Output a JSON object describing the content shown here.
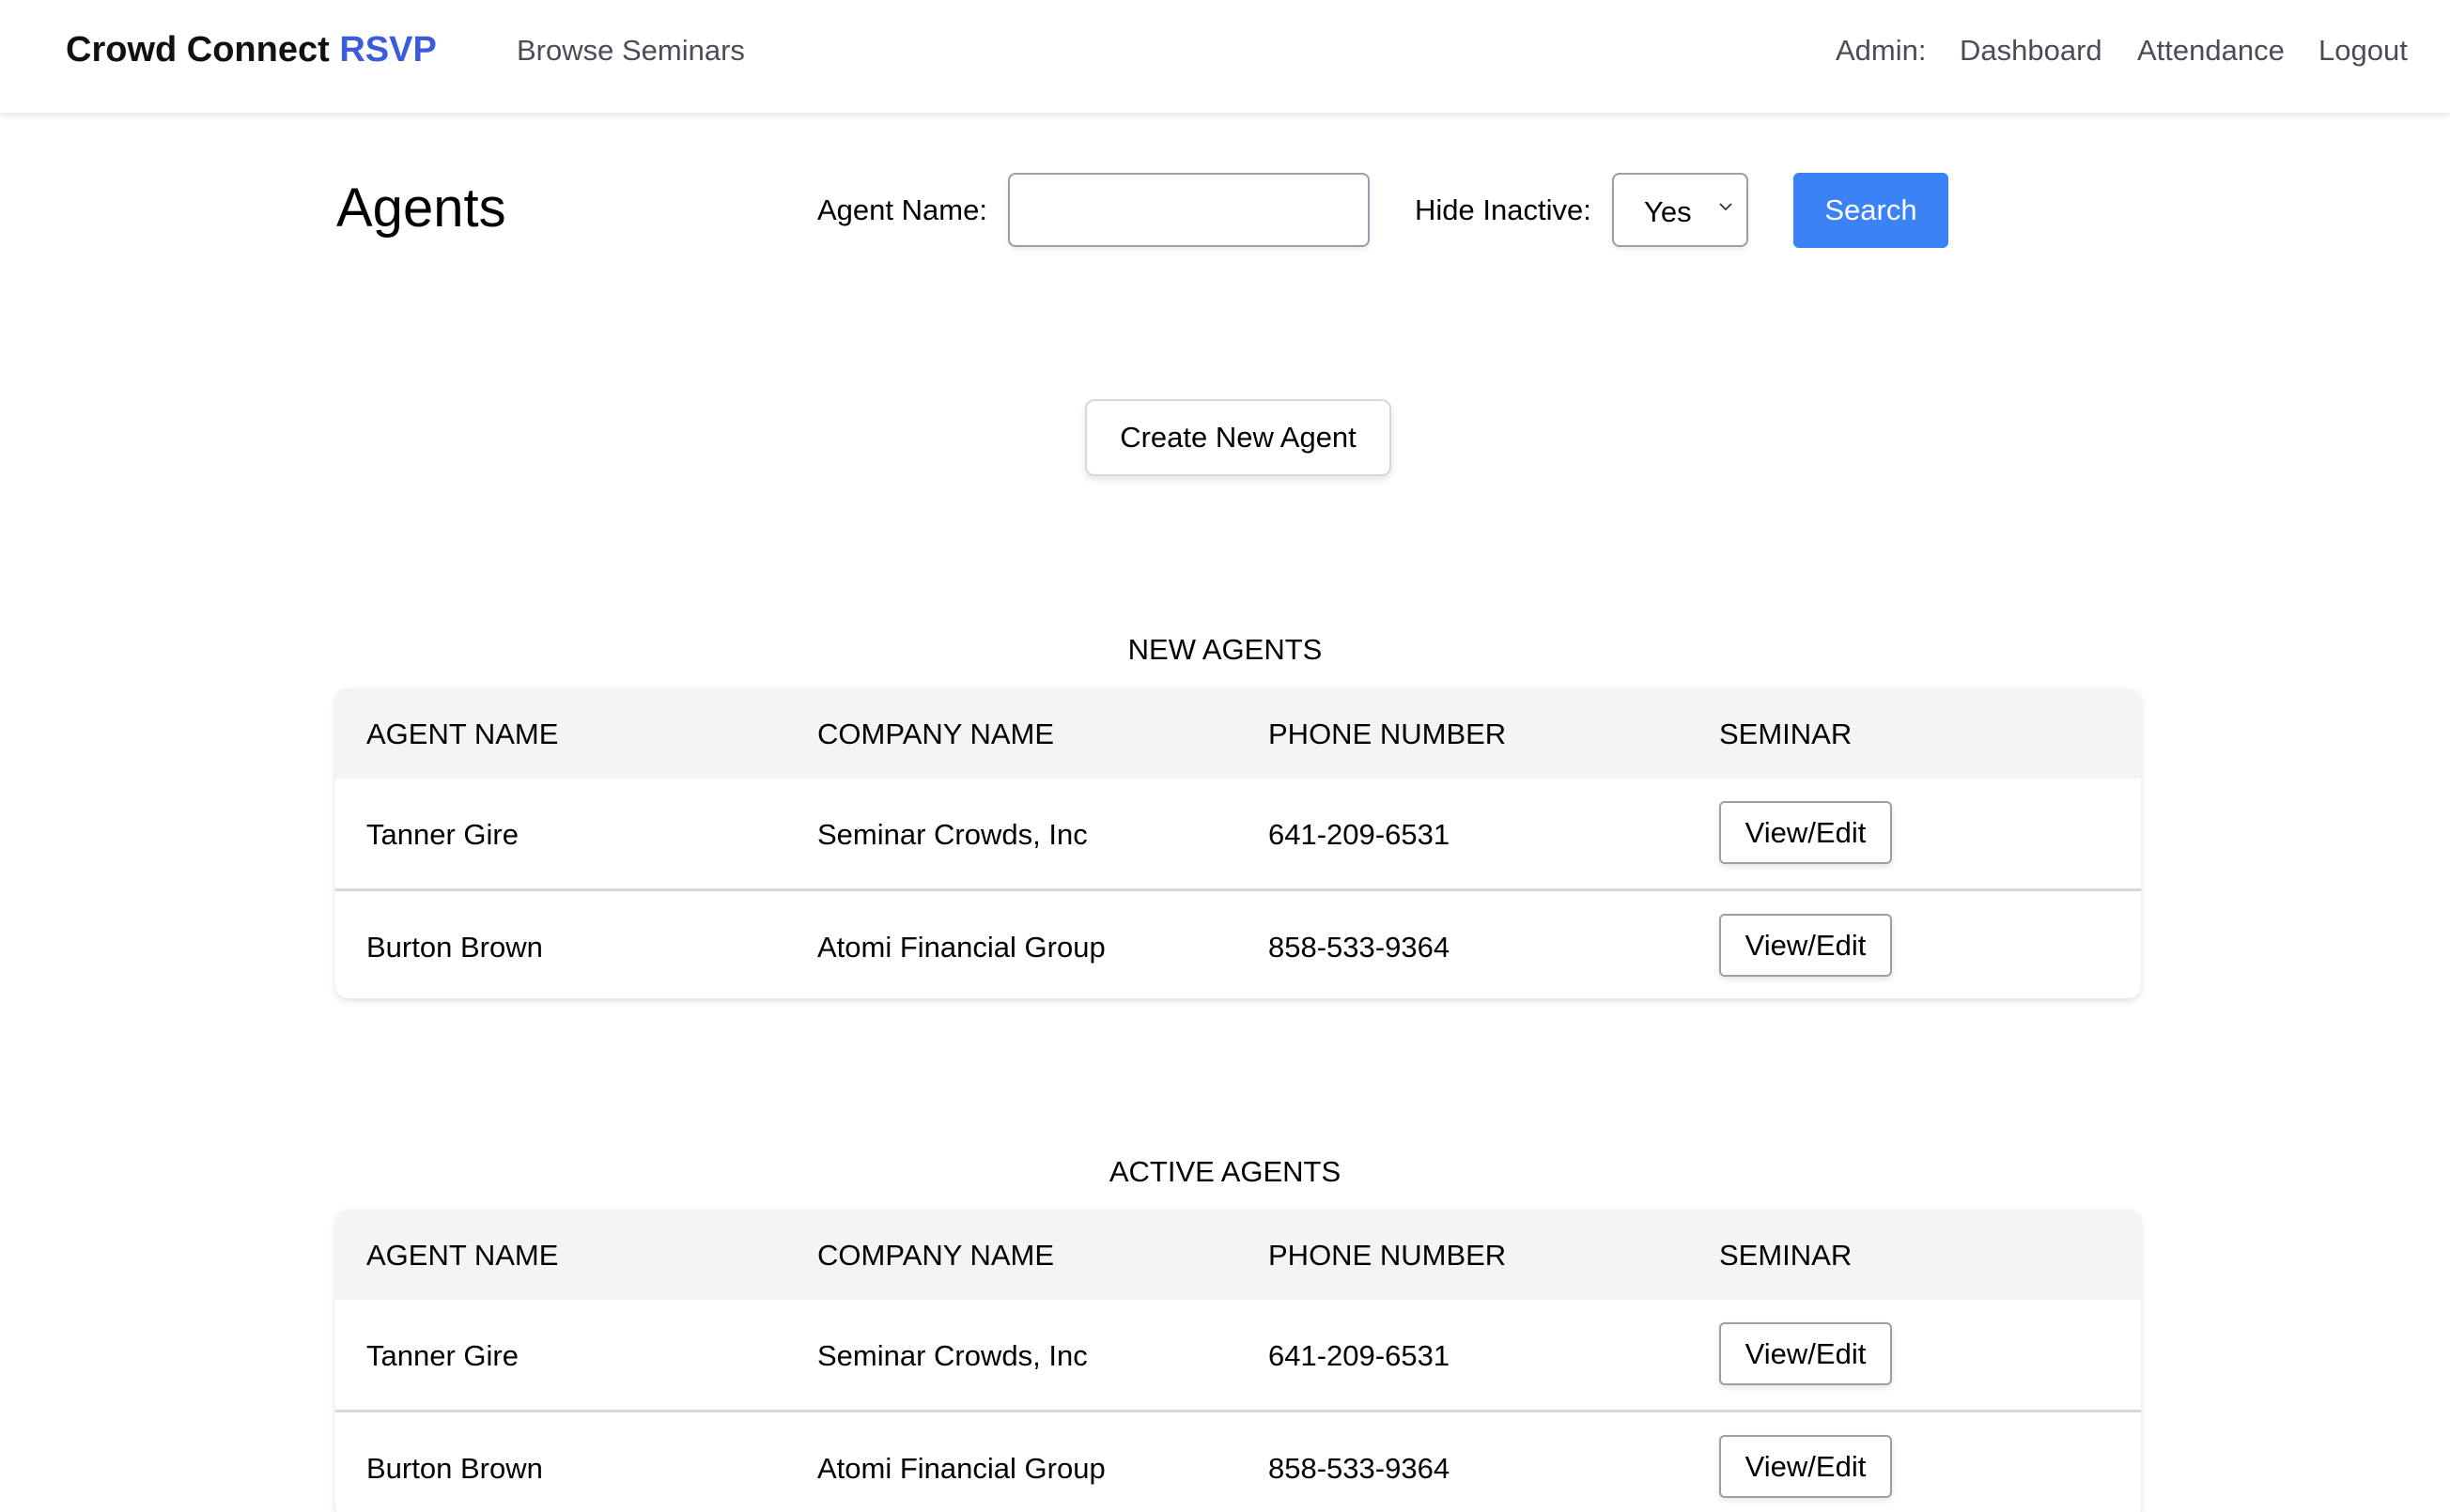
{
  "header": {
    "brand": "Crowd Connect",
    "brand_accent": "RSVP",
    "nav_browse": "Browse Seminars",
    "admin_label": "Admin:",
    "nav_dashboard": "Dashboard",
    "nav_attendance": "Attendance",
    "nav_logout": "Logout"
  },
  "page": {
    "title": "Agents",
    "agent_name_label": "Agent Name:",
    "agent_name_value": "",
    "hide_inactive_label": "Hide Inactive:",
    "hide_inactive_value": "Yes",
    "search_label": "Search",
    "create_label": "Create New Agent"
  },
  "colors": {
    "brand_accent": "#3b5bdb",
    "primary_button": "#3b82f6",
    "table_header_bg": "#f3f4f6"
  },
  "columns": [
    "AGENT NAME",
    "COMPANY NAME",
    "PHONE NUMBER",
    "SEMINAR"
  ],
  "new_agents": {
    "title": "NEW AGENTS",
    "rows": [
      {
        "name": "Tanner Gire",
        "company": "Seminar Crowds, Inc",
        "phone": "641-209-6531",
        "action": "View/Edit"
      },
      {
        "name": "Burton Brown",
        "company": "Atomi Financial Group",
        "phone": "858-533-9364",
        "action": "View/Edit"
      }
    ]
  },
  "active_agents": {
    "title": "ACTIVE AGENTS",
    "rows": [
      {
        "name": "Tanner Gire",
        "company": "Seminar Crowds, Inc",
        "phone": "641-209-6531",
        "action": "View/Edit"
      },
      {
        "name": "Burton Brown",
        "company": "Atomi Financial Group",
        "phone": "858-533-9364",
        "action": "View/Edit"
      }
    ]
  }
}
